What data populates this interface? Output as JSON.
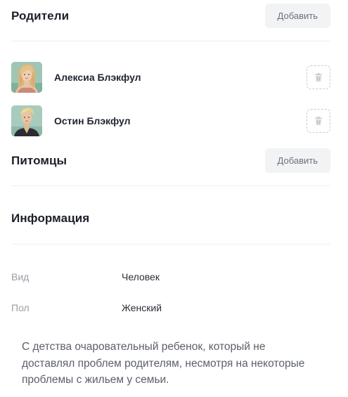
{
  "parents": {
    "title": "Родители",
    "add_label": "Добавить",
    "items": [
      {
        "name": "Алексиа Блэкфул",
        "avatar": "female-avatar"
      },
      {
        "name": "Остин Блэкфул",
        "avatar": "male-avatar"
      }
    ]
  },
  "pets": {
    "title": "Питомцы",
    "add_label": "Добавить"
  },
  "info": {
    "title": "Информация",
    "rows": [
      {
        "label": "Вид",
        "value": "Человек"
      },
      {
        "label": "Пол",
        "value": "Женский"
      }
    ],
    "description": "С детства очаровательный ребенок, который не доставлял проблем родителям, несмотря на некоторые проблемы с жильем у семьи."
  },
  "colors": {
    "title": "#1b1f2a",
    "muted_label": "#9a9ea6",
    "button_bg": "#f2f3f5",
    "divider": "#eceef1"
  }
}
